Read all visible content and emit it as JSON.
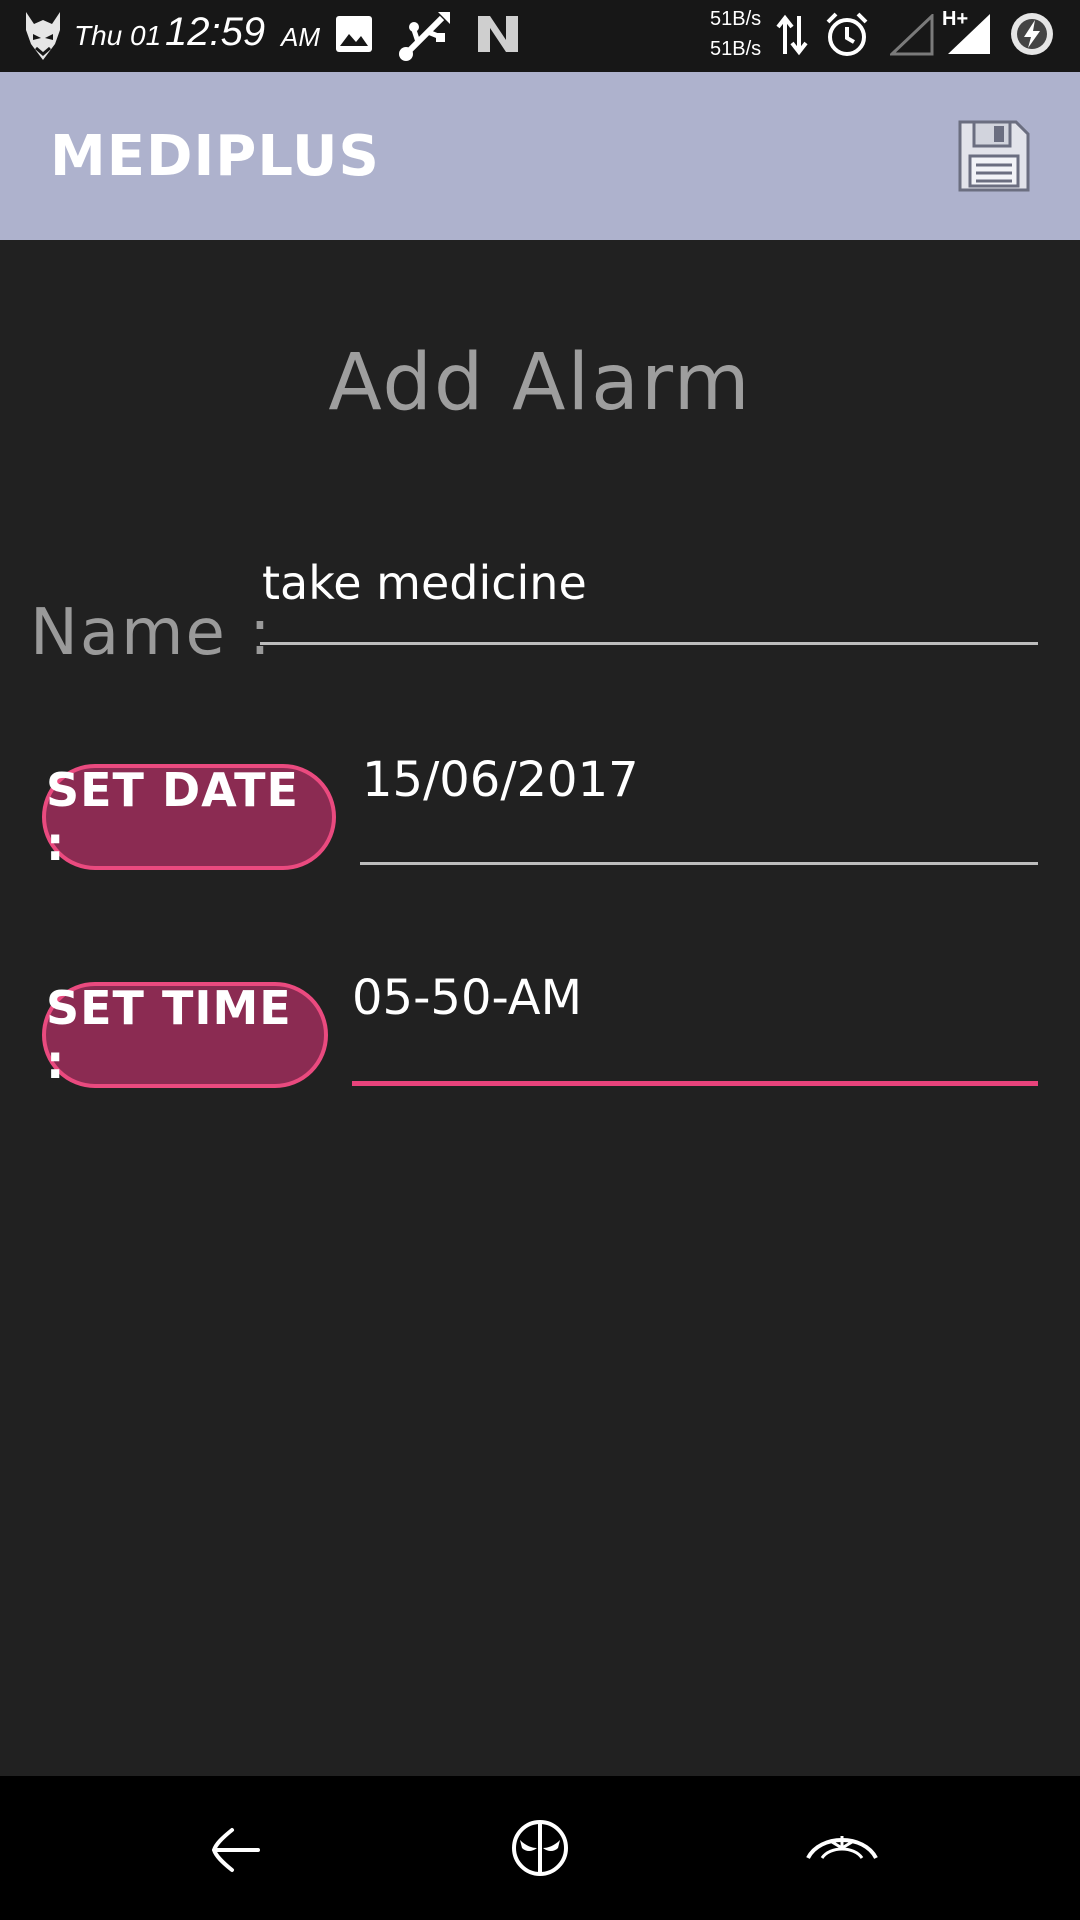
{
  "status_bar": {
    "day": "Thu 01",
    "time": "12:59",
    "ampm": "AM",
    "net_up": "51B/s",
    "net_down": "51B/s",
    "network_type": "H+",
    "icons": [
      "devil-logo-icon",
      "image-icon",
      "usb-icon",
      "n-icon",
      "data-arrows-icon",
      "alarm-icon",
      "signal-empty-icon",
      "signal-full-icon",
      "battery-charging-icon"
    ]
  },
  "app_bar": {
    "title": "MEDIPLUS",
    "save_icon": "floppy-disk-icon"
  },
  "form": {
    "heading": "Add Alarm",
    "name_label": "Name :",
    "name_value": "take medicine",
    "set_date_label": "SET DATE :",
    "date_value": "15/06/2017",
    "set_time_label": "SET TIME :",
    "time_value": "05-50-AM"
  },
  "nav_bar": {
    "icons": [
      "back-icon",
      "home-icon",
      "recents-icon"
    ]
  },
  "colors": {
    "app_bar": "#aeb2cd",
    "background": "#212121",
    "accent": "#e8437b",
    "pill_fill": "#8b2b52"
  }
}
